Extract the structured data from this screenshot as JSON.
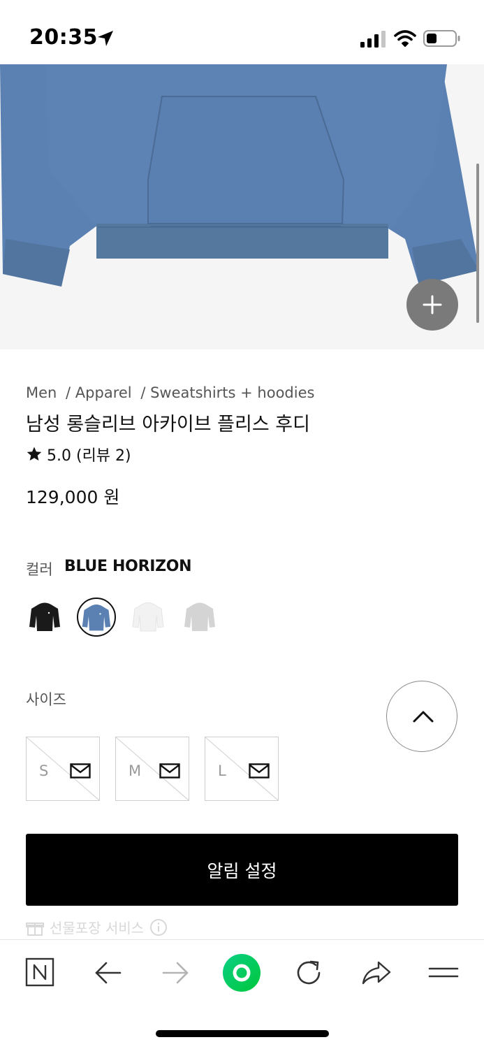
{
  "status_bar": {
    "time": "20:35",
    "icons": [
      "location-arrow-icon",
      "cellular-signal-icon",
      "wifi-icon",
      "battery-icon"
    ]
  },
  "hero": {
    "image": "blue-hoodie-product-photo",
    "product_color": "#5b80b2",
    "zoom_icon": "plus-icon"
  },
  "product": {
    "breadcrumb": [
      "Men",
      "/ Apparel",
      "/ Sweatshirts + hoodies"
    ],
    "title": "남성 롱슬리브 아카이브 플리스 후디",
    "rating": "5.0 (리뷰 2)",
    "price": "129,000 원"
  },
  "color": {
    "label": "컬러",
    "selected": "BLUE HORIZON",
    "swatches": [
      {
        "name": "black",
        "hex": "#1a1a1a"
      },
      {
        "name": "blue-horizon",
        "hex": "#5b80b2",
        "selected": true
      },
      {
        "name": "white",
        "hex": "#f2f2f2"
      },
      {
        "name": "grey",
        "hex": "#d4d4d4"
      }
    ]
  },
  "size": {
    "label": "사이즈",
    "options": [
      "S",
      "M",
      "L"
    ],
    "sold_out": true
  },
  "actions": {
    "notify_label": "알림 설정",
    "gift_label": "선물포장 서비스"
  },
  "toolbar": {
    "items": [
      "naver-n-icon",
      "back-arrow-icon",
      "forward-arrow-icon",
      "green-dot-icon",
      "refresh-icon",
      "share-icon",
      "menu-icon"
    ],
    "accent": "#03c75a"
  }
}
